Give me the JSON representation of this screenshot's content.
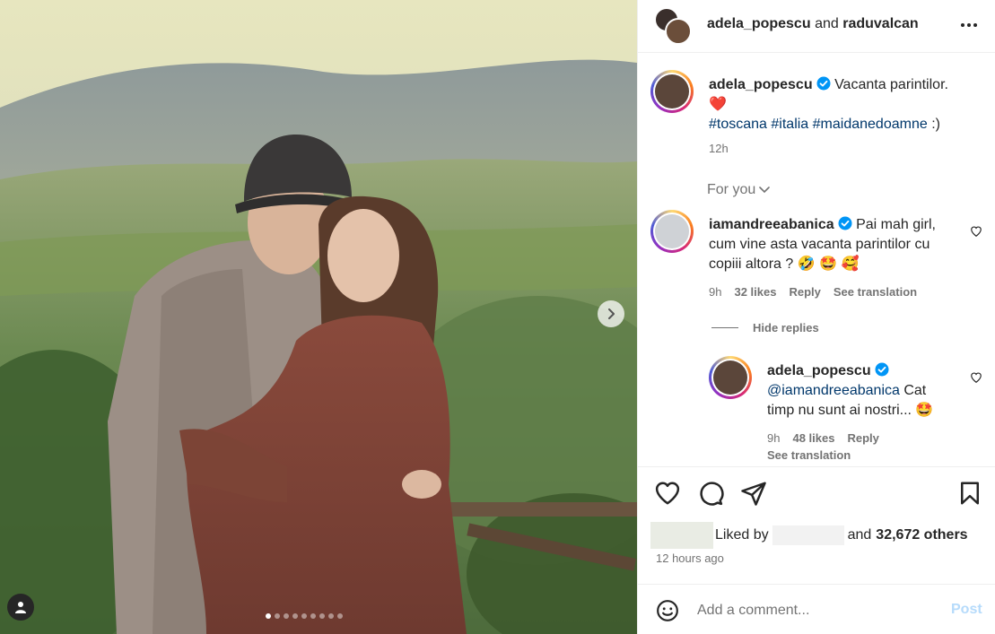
{
  "header": {
    "user1": "adela_popescu",
    "joiner": "and",
    "user2": "raduvalcan",
    "more_icon": "more-horizontal-icon"
  },
  "caption": {
    "username": "adela_popescu",
    "text": "Vacanta parintilor.",
    "emoji": "❤️",
    "hashtags": [
      "#toscana",
      "#italia",
      "#maidanedoamne"
    ],
    "suffix": ":)",
    "time": "12h"
  },
  "for_you": "For you",
  "comment": {
    "username": "iamandreeabanica",
    "text": "Pai mah girl, cum vine asta vacanta parintilor cu copiii altora ? 🤣 🤩 🥰",
    "time": "9h",
    "likes": "32 likes",
    "reply": "Reply",
    "see_translation": "See translation"
  },
  "hide_replies": "Hide replies",
  "reply": {
    "username": "adela_popescu",
    "mention": "@iamandreeabanica",
    "text": "Cat timp nu sunt ai nostri... 🤩",
    "time": "9h",
    "likes": "48 likes",
    "reply": "Reply",
    "see_translation": "See translation"
  },
  "actions": {
    "like_icon": "heart-icon",
    "comment_icon": "comment-icon",
    "share_icon": "paper-plane-icon",
    "save_icon": "bookmark-icon"
  },
  "likes": {
    "prefix": "Liked by",
    "joiner": "and",
    "count": "32,672 others"
  },
  "posted": "12 hours ago",
  "add_comment": {
    "placeholder": "Add a comment...",
    "post": "Post"
  },
  "carousel": {
    "total": 9,
    "current": 1
  },
  "colors": {
    "verified": "#0095f6",
    "link": "#00376b",
    "muted": "#737373",
    "post_disabled": "#b6dbfb"
  }
}
